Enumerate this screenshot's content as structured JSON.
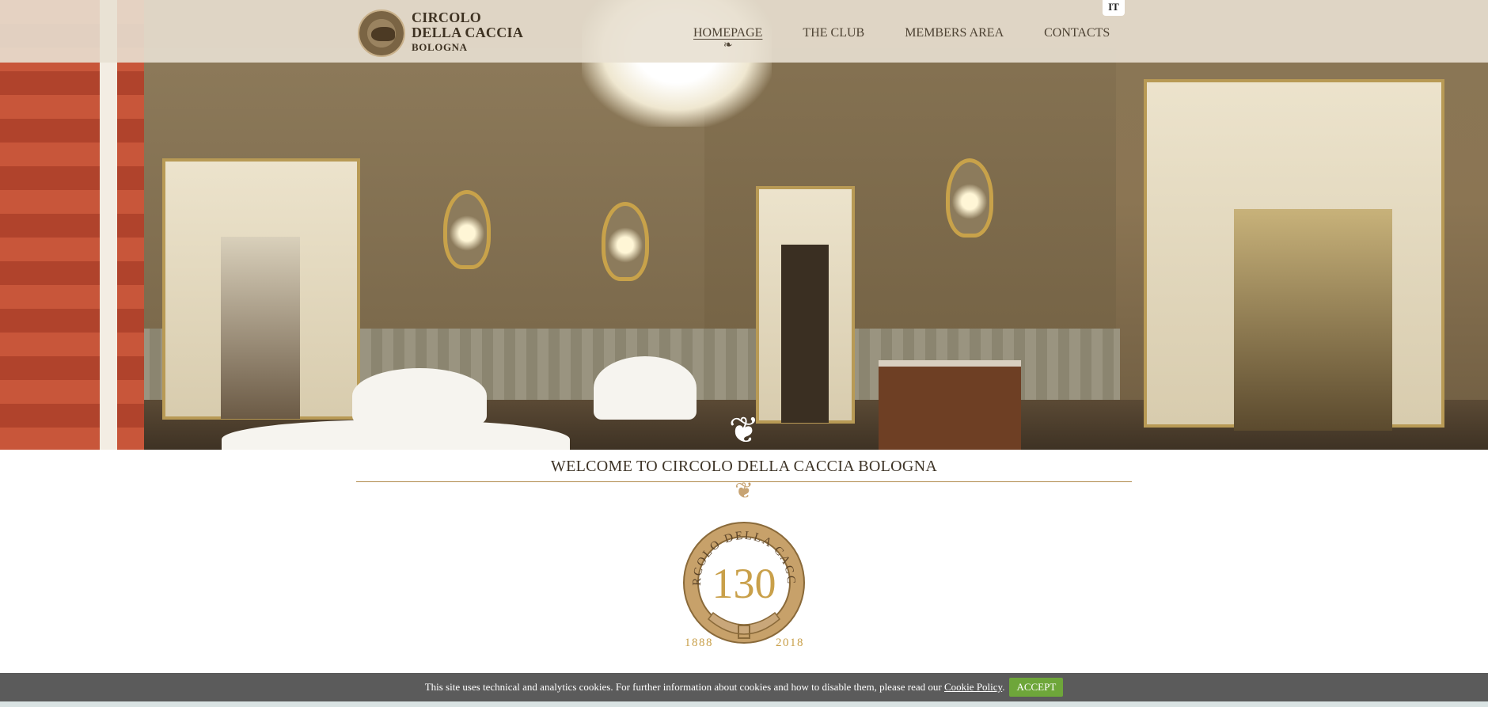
{
  "language_toggle": "IT",
  "logo": {
    "line1": "CIRCOLO",
    "line2": "DELLA CACCIA",
    "line3": "BOLOGNA"
  },
  "nav": {
    "items": [
      {
        "label": "HOMEPAGE",
        "active": true
      },
      {
        "label": "THE CLUB",
        "active": false
      },
      {
        "label": "MEMBERS AREA",
        "active": false
      },
      {
        "label": "CONTACTS",
        "active": false
      }
    ]
  },
  "welcome": {
    "title": "WELCOME TO CIRCOLO DELLA CACCIA BOLOGNA"
  },
  "anniversary_badge": {
    "ring_text": "CIRCOLO DELLA CACCIA",
    "number": "130",
    "year_start": "1888",
    "year_end": "2018"
  },
  "cookie_banner": {
    "message": "This site uses technical and analytics cookies. For further information about cookies and how to disable them, please read our",
    "link_label": "Cookie Policy",
    "punctuation": ".",
    "accept_label": "ACCEPT"
  },
  "colors": {
    "accent_gold": "#b08a4c",
    "accept_green": "#6ea63a",
    "cookie_bar": "#525252"
  }
}
